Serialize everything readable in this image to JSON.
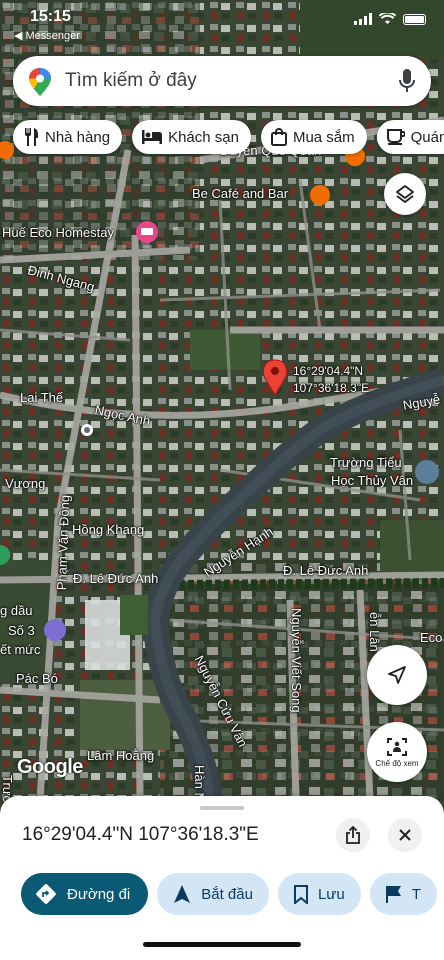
{
  "status_bar": {
    "time": "15:15",
    "back_app": "◀ Messenger"
  },
  "search": {
    "placeholder": "Tìm kiếm ở đây"
  },
  "chips": [
    {
      "icon": "restaurant-icon",
      "label": "Nhà hàng"
    },
    {
      "icon": "hotel-icon",
      "label": "Khách sạn"
    },
    {
      "icon": "shopping-bag-icon",
      "label": "Mua sắm"
    },
    {
      "icon": "coffee-icon",
      "label": "Quán"
    }
  ],
  "map": {
    "pin_label": {
      "line1": "16°29'04.4\"N",
      "line2": "107°36'18.3\"E"
    },
    "places": {
      "duyen_que_quan": "Duyên Quê Quán",
      "be_cafe": "Be Café and Bar",
      "hue_eco": "Huế Eco Homestay",
      "truong_tieu_hoc_1": "Trường Tiểu",
      "truong_tieu_hoc_2": "Học Thủy Vân",
      "hong_khang": "Hồng Khang",
      "so3": "Số 3",
      "dau": "g dầu",
      "muc": "ết mức",
      "eco": "Eco"
    },
    "streets": {
      "dinh_ngang": "Đinh Ngang",
      "lai_the": "Lại Thế",
      "ngoc_anh": "Ngọc Anh",
      "vuong": "Vương",
      "pham_van_dong": "Phạm Văn Đồng",
      "le_duc_anh_left": "Đ. Lê Đức Anh",
      "le_duc_anh_right": "Đ. Lê Đức Anh",
      "nguyen_hanh": "Nguyễn Hạnh",
      "nguyen_cuu_van": "Nguyễn Cửu Vân",
      "nguyen_viet_song": "Nguyễn Viết Song",
      "pac_bo": "Pác Bó",
      "lam_hoang": "Lâm Hoằng",
      "nguye": "Nguyễ",
      "pham_top": "Phạ",
      "nhung": "hương",
      "ghi_mai": "g Mai",
      "han_m": "Hàn M",
      "tuong": "Trườ",
      "an_lan": "ễn Lân"
    },
    "google_logo": "Google"
  },
  "buttons": {
    "street_view_label": "Chế độ xem"
  },
  "sheet": {
    "coords": "16°29'04.4\"N 107°36'18.3\"E",
    "actions": [
      {
        "label": "Đường đi",
        "primary": true
      },
      {
        "label": "Bắt đầu",
        "primary": false
      },
      {
        "label": "Lưu",
        "primary": false
      },
      {
        "label": "T",
        "primary": false
      }
    ]
  },
  "colors": {
    "accent": "#0b5a75",
    "chip_blue": "#d3e6f5",
    "pin_red": "#ea4335"
  }
}
